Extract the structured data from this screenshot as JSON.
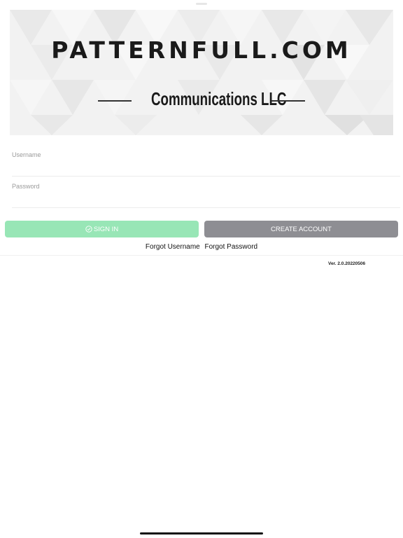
{
  "banner": {
    "brand": "PATTERNFULL.COM",
    "company": "Communications LLC"
  },
  "form": {
    "username": {
      "label": "Username",
      "value": ""
    },
    "password": {
      "label": "Password",
      "value": ""
    }
  },
  "actions": {
    "sign_in_label": "SIGN IN",
    "sign_in_icon": "check-circle-icon",
    "create_account_label": "CREATE ACCOUNT"
  },
  "links": {
    "forgot_username": "Forgot Username",
    "forgot_password": "Forgot Password"
  },
  "footer": {
    "version": "Ver. 2.0.20220506"
  },
  "colors": {
    "sign_in_button": "#98e6b6",
    "create_account_button": "#8e8e93",
    "banner_background": "#f3f3f3"
  }
}
